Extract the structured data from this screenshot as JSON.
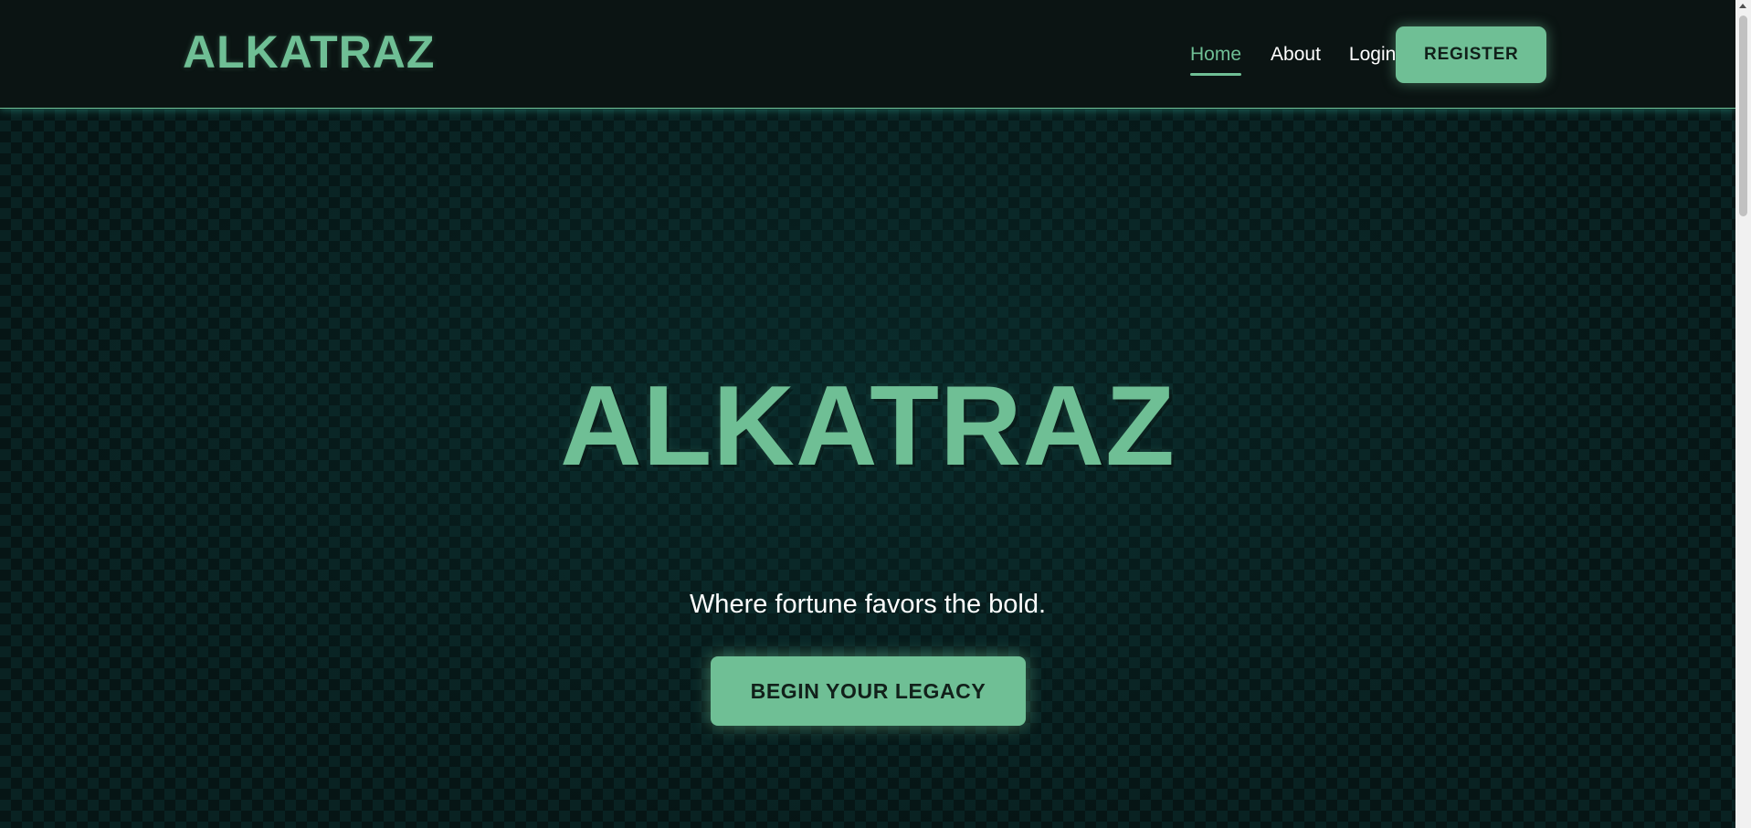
{
  "header": {
    "logo": "ALKATRAZ",
    "nav": {
      "home": "Home",
      "about": "About",
      "login": "Login",
      "register": "REGISTER"
    }
  },
  "hero": {
    "title": "ALKATRAZ",
    "tagline": "Where fortune favors the bold.",
    "cta": "BEGIN YOUR LEGACY"
  },
  "colors": {
    "accent": "#6fbf95",
    "header_bg": "#0b1413",
    "hero_bg": "#071717",
    "pattern": "#0c2b2b",
    "text": "#ffffff"
  },
  "icons": {
    "scroll_up": "scroll-up-arrow-icon"
  }
}
